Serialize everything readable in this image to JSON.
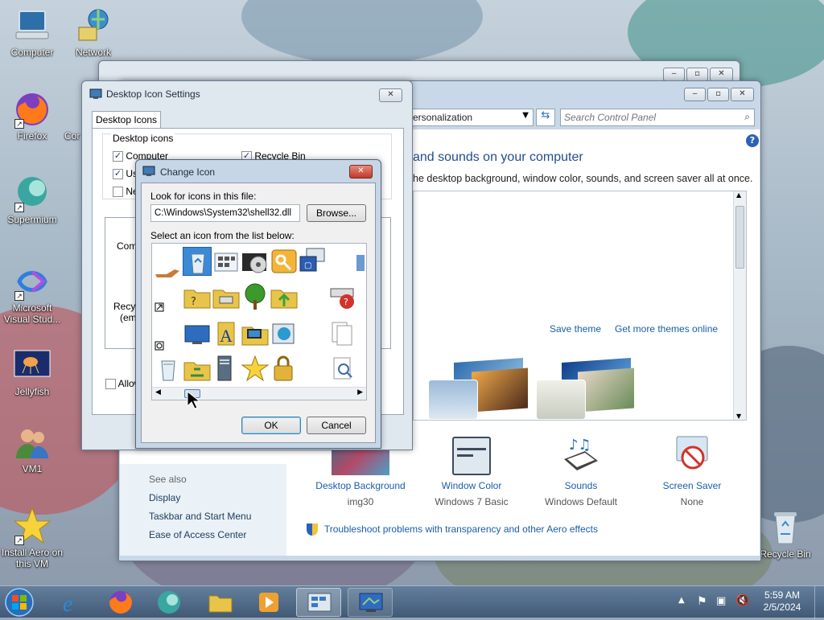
{
  "desktop": {
    "icons": [
      {
        "label": "Computer"
      },
      {
        "label": "Network"
      },
      {
        "label": "Firefox"
      },
      {
        "label": "Cor"
      },
      {
        "label": "Supermium"
      },
      {
        "label": "Microsoft Visual Stud..."
      },
      {
        "label": "Jellyfish"
      },
      {
        "label": "VM1"
      },
      {
        "label": "Install Aero on this VM"
      },
      {
        "label": "Recycle Bin"
      }
    ]
  },
  "personalization": {
    "address": "ersonalization",
    "search_placeholder": "Search Control Panel",
    "heading": "and sounds on your computer",
    "subheading": "he desktop background, window color, sounds, and screen saver all at once.",
    "save_theme": "Save theme",
    "get_more_themes": "Get more themes online",
    "see_also_label": "See also",
    "see_also_links": [
      "Display",
      "Taskbar and Start Menu",
      "Ease of Access Center"
    ],
    "settings": [
      {
        "title": "Desktop Background",
        "value": "img30"
      },
      {
        "title": "Window Color",
        "value": "Windows 7 Basic"
      },
      {
        "title": "Sounds",
        "value": "Windows Default"
      },
      {
        "title": "Screen Saver",
        "value": "None"
      }
    ],
    "troubleshoot": "Troubleshoot problems with transparency and other Aero effects"
  },
  "desktop_icon_settings": {
    "title": "Desktop Icon Settings",
    "tab": "Desktop Icons",
    "group_label": "Desktop icons",
    "checks": [
      {
        "label": "Computer",
        "checked": true
      },
      {
        "label": "Recycle Bin",
        "checked": true
      },
      {
        "label": "Use",
        "checked": true
      },
      {
        "label": "Ne",
        "checked": false
      }
    ],
    "preview_labels": [
      "Comp",
      "Recyc",
      "(emp"
    ],
    "allow_label": "Allow"
  },
  "change_icon": {
    "title": "Change Icon",
    "look_label": "Look for icons in this file:",
    "file_path": "C:\\Windows\\System32\\shell32.dll",
    "browse_label": "Browse...",
    "select_label": "Select an icon from the list below:",
    "ok_label": "OK",
    "cancel_label": "Cancel"
  },
  "taskbar": {
    "time": "5:59 AM",
    "date": "2/5/2024"
  },
  "colors": {
    "link": "#1a5ea8",
    "heading": "#1f4e8c",
    "close_red": "#c0392b"
  }
}
